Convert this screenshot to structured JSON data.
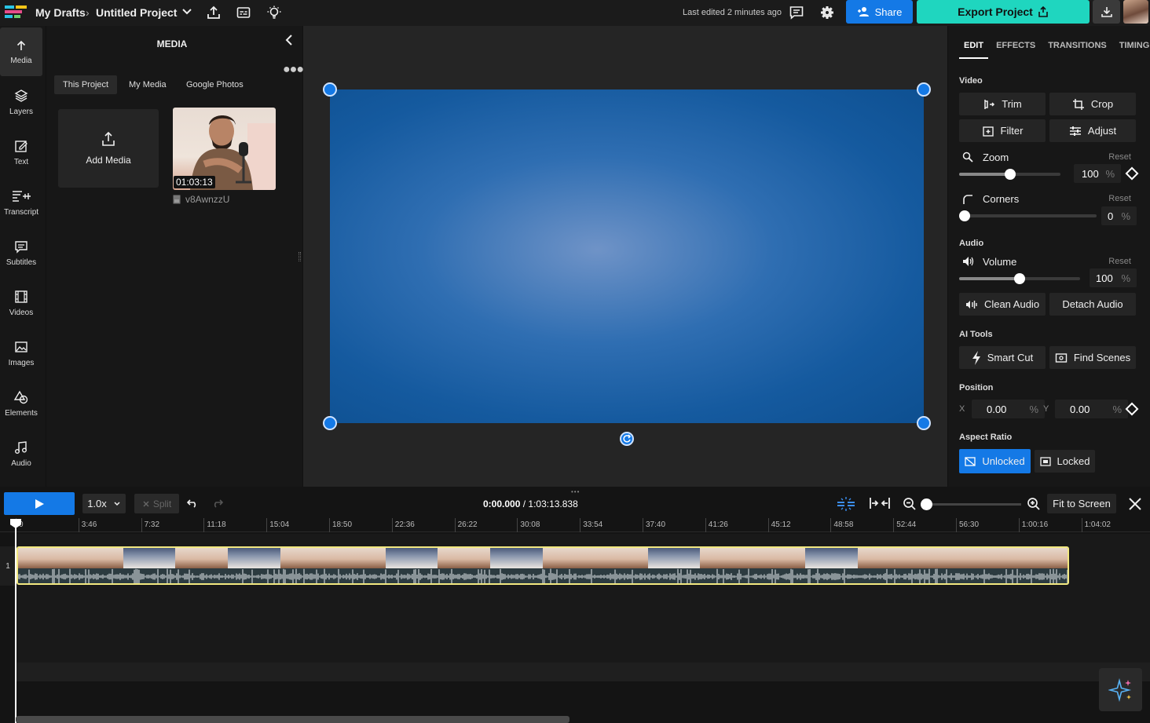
{
  "topbar": {
    "breadcrumb_root": "My Drafts",
    "separator": "›",
    "project_name": "Untitled Project",
    "last_edited": "Last edited 2 minutes ago",
    "share_label": "Share",
    "export_label": "Export Project"
  },
  "nav": [
    {
      "label": "Media",
      "icon": "upload-icon"
    },
    {
      "label": "Layers",
      "icon": "layers-icon"
    },
    {
      "label": "Text",
      "icon": "text-edit-icon"
    },
    {
      "label": "Transcript",
      "icon": "transcript-icon"
    },
    {
      "label": "Subtitles",
      "icon": "subtitles-icon"
    },
    {
      "label": "Videos",
      "icon": "film-icon"
    },
    {
      "label": "Images",
      "icon": "image-icon"
    },
    {
      "label": "Elements",
      "icon": "shapes-icon"
    },
    {
      "label": "Audio",
      "icon": "music-note-icon"
    }
  ],
  "media_panel": {
    "title": "MEDIA",
    "tabs": [
      "This Project",
      "My Media",
      "Google Photos"
    ],
    "add_media_label": "Add Media",
    "item": {
      "duration": "01:03:13",
      "filename": "v8AwnzzU"
    }
  },
  "properties": {
    "tabs": [
      "EDIT",
      "EFFECTS",
      "TRANSITIONS",
      "TIMING"
    ],
    "video_section": "Video",
    "trim_label": "Trim",
    "crop_label": "Crop",
    "filter_label": "Filter",
    "adjust_label": "Adjust",
    "zoom_label": "Zoom",
    "zoom_value": "100",
    "corners_label": "Corners",
    "corners_value": "0",
    "reset_label": "Reset",
    "percent": "%",
    "audio_section": "Audio",
    "volume_label": "Volume",
    "volume_value": "100",
    "clean_audio_label": "Clean Audio",
    "detach_audio_label": "Detach Audio",
    "ai_section": "AI Tools",
    "smart_cut_label": "Smart Cut",
    "find_scenes_label": "Find Scenes",
    "position_section": "Position",
    "x_label": "X",
    "x_value": "0.00",
    "y_label": "Y",
    "y_value": "0.00",
    "aspect_section": "Aspect Ratio",
    "unlocked_label": "Unlocked",
    "locked_label": "Locked",
    "zoom_level_fraction": 0.5,
    "corners_level_fraction": 0.0,
    "volume_level_fraction": 0.5
  },
  "timeline": {
    "speed": "1.0x",
    "split_label": "Split",
    "current_time": "0:00.000",
    "time_separator": " / ",
    "total_time": "1:03:13.838",
    "fit_label": "Fit to Screen",
    "track_number": "1",
    "ruler": [
      "0",
      "3:46",
      "7:32",
      "11:18",
      "15:04",
      "18:50",
      "22:36",
      "26:22",
      "30:08",
      "33:54",
      "37:40",
      "41:26",
      "45:12",
      "48:58",
      "52:44",
      "56:30",
      "1:00:16",
      "1:04:02"
    ]
  },
  "colors": {
    "accent": "#1479e6",
    "export": "#1fd6bf",
    "clip_border": "#f2e880"
  }
}
